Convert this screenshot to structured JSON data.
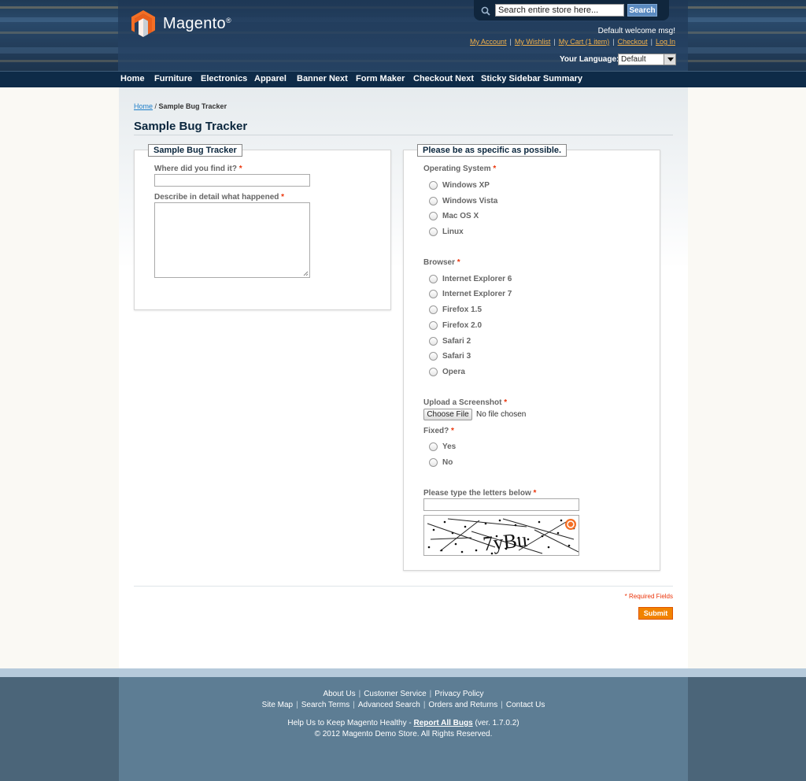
{
  "brand": {
    "name": "Magento",
    "reg": "®"
  },
  "search": {
    "placeholder": "Search entire store here...",
    "button": "Search"
  },
  "header": {
    "welcome": "Default welcome msg!",
    "links": [
      "My Account",
      "My Wishlist",
      "My Cart (1 item)",
      "Checkout",
      "Log In"
    ],
    "language_label": "Your Language:",
    "language_value": "Default"
  },
  "nav": [
    "Home",
    "Furniture",
    "Electronics",
    "Apparel",
    "Banner Next",
    "Form Maker",
    "Checkout Next",
    "Sticky Sidebar Summary"
  ],
  "breadcrumb": {
    "home": "Home",
    "sep": " / ",
    "current": "Sample Bug Tracker"
  },
  "page_title": "Sample Bug Tracker",
  "left_form": {
    "legend": "Sample Bug Tracker",
    "found_label": "Where did you find it?",
    "detail_label": "Describe in detail what happened",
    "required_mark": "*"
  },
  "right_form": {
    "legend": "Please be as specific as possible.",
    "os_label": "Operating System",
    "os_options": [
      "Windows XP",
      "Windows Vista",
      "Mac OS X",
      "Linux"
    ],
    "browser_label": "Browser",
    "browser_options": [
      "Internet Explorer 6",
      "Internet Explorer 7",
      "Firefox 1.5",
      "Firefox 2.0",
      "Safari 2",
      "Safari 3",
      "Opera"
    ],
    "upload_label": "Upload a Screenshot",
    "file_button": "Choose File",
    "file_status": "No file chosen",
    "fixed_label": "Fixed?",
    "fixed_options": [
      "Yes",
      "No"
    ],
    "captcha_label": "Please type the letters below",
    "captcha_text": "7yBu",
    "required_mark": "*"
  },
  "form_footer": {
    "required_note": "* Required Fields",
    "submit": "Submit"
  },
  "footer": {
    "row1": [
      "About Us",
      "Customer Service",
      "Privacy Policy"
    ],
    "row2": [
      "Site Map",
      "Search Terms",
      "Advanced Search",
      "Orders and Returns",
      "Contact Us"
    ],
    "help_prefix": "Help Us to Keep Magento Healthy - ",
    "help_link": "Report All Bugs",
    "help_suffix": " (ver. 1.7.0.2)",
    "copyright": "© 2012 Magento Demo Store. All Rights Reserved."
  },
  "colors": {
    "accent": "#f18200",
    "link": "#1e7ec8",
    "required": "#eb340a",
    "nav_bg": "#0e2b48"
  }
}
